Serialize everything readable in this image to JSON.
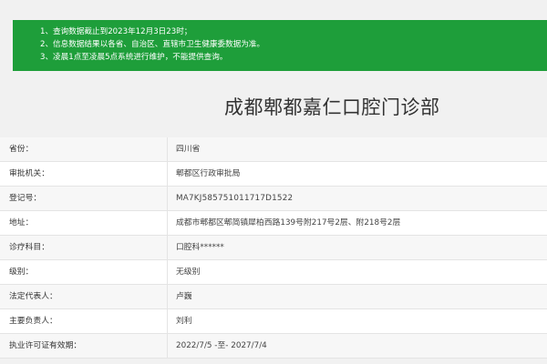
{
  "notice": {
    "lines": [
      "1、查询数据截止到2023年12月3日23时；",
      "2、信息数据结果以各省、自治区、直辖市卫生健康委数据为准。",
      "3、凌晨1点至凌晨5点系统进行维护，不能提供查询。"
    ],
    "bg_color": "#1e9e3a"
  },
  "title": "成都郫都嘉仁口腔门诊部",
  "fields": [
    {
      "label": "省份：",
      "value": "四川省"
    },
    {
      "label": "审批机关：",
      "value": "郫都区行政审批局"
    },
    {
      "label": "登记号：",
      "value": "MA7KJ585751011717D1522"
    },
    {
      "label": "地址：",
      "value": "成都市郫都区郫简镇犀柏西路139号附217号2层、附218号2层"
    },
    {
      "label": "诊疗科目：",
      "value": "口腔科******"
    },
    {
      "label": "级别：",
      "value": "无级别"
    },
    {
      "label": "法定代表人：",
      "value": "卢巍"
    },
    {
      "label": "主要负责人：",
      "value": "刘利"
    },
    {
      "label": "执业许可证有效期：",
      "value": "2022/7/5 -至- 2027/7/4"
    }
  ]
}
